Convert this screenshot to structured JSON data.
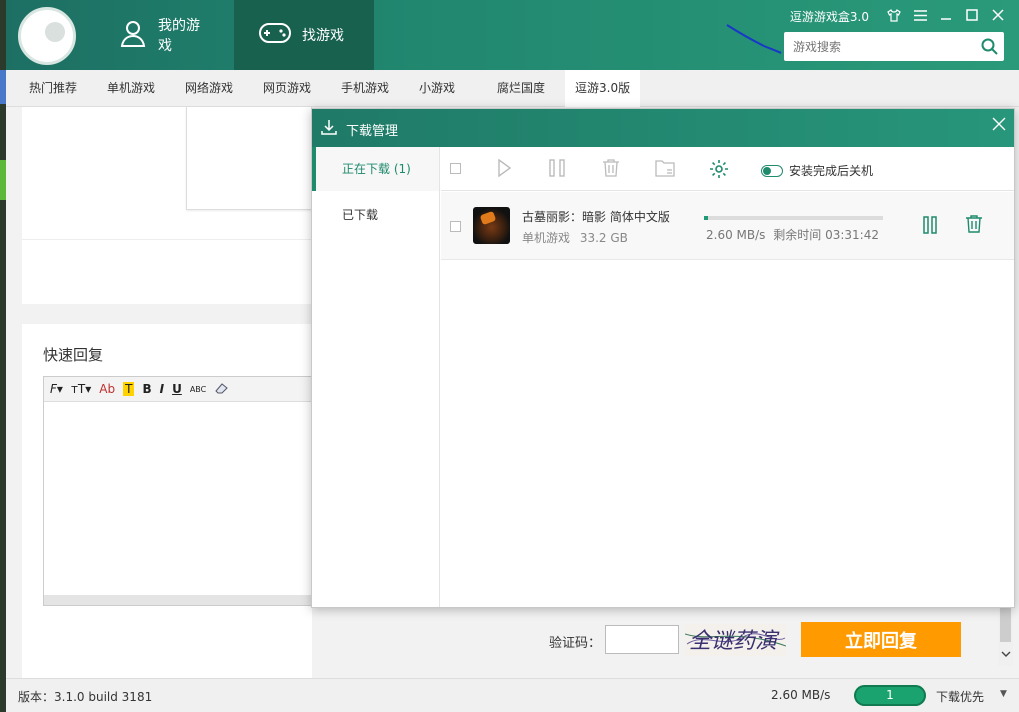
{
  "app": {
    "brand": "逗游游戏盒3.0",
    "nav": {
      "my_games": "我的游戏",
      "find_games": "找游戏"
    },
    "search": {
      "placeholder": "游戏搜索"
    }
  },
  "subnav": [
    "热门推荐",
    "单机游戏",
    "网络游戏",
    "网页游戏",
    "手机游戏",
    "小游戏",
    "腐烂国度",
    "逗游3.0版"
  ],
  "reply": {
    "title": "快速回复",
    "toolbar": [
      "F▾",
      "тT▾",
      "Ab",
      "T",
      "B",
      "I",
      "U",
      "ABC"
    ],
    "verify_label": "验证码：",
    "captcha_text": "全谜药演",
    "submit": "立即回复"
  },
  "download_manager": {
    "title": "下载管理",
    "tabs": [
      "正在下载 (1)",
      "已下载"
    ],
    "auto_shutdown": "安装完成后关机",
    "items": [
      {
        "name": "古墓丽影：暗影 简体中文版",
        "category": "单机游戏",
        "size": "33.2 GB",
        "speed": "2.60 MB/s",
        "remaining": "剩余时间 03:31:42",
        "progress": 0.02
      }
    ]
  },
  "status": {
    "version": "版本：3.1.0 build 3181",
    "speed": "2.60 MB/s",
    "count": "1",
    "priority": "下载优先"
  },
  "colors": {
    "accent": "#1f8a6c",
    "header": "#21876f",
    "button": "#ff9a00"
  }
}
